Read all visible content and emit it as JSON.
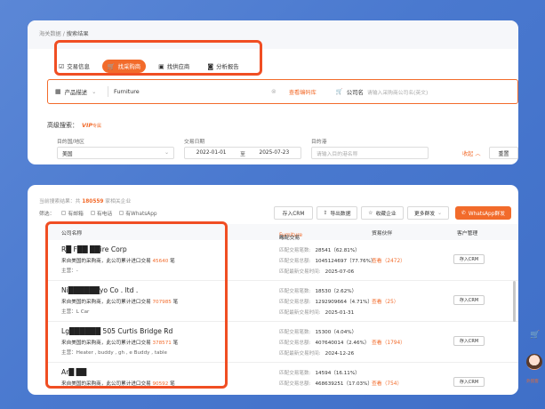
{
  "colors": {
    "accent": "#f26b2b",
    "highlight_box": "#f04e23",
    "background": "#4a79cf"
  },
  "breadcrumb": {
    "parent": "海关数据",
    "separator": " / ",
    "current": "搜索结果"
  },
  "mode_tabs": [
    {
      "label": "交易信息",
      "icon": "document-icon",
      "active": false
    },
    {
      "label": "找采购商",
      "icon": "cart-icon",
      "active": true
    },
    {
      "label": "找供应商",
      "icon": "supplier-icon",
      "active": false
    },
    {
      "label": "分析报告",
      "icon": "report-icon",
      "active": false
    }
  ],
  "search": {
    "type_label": "产品描述",
    "value": "Furniture",
    "code_link": "查看编码库",
    "company_label": "公司名",
    "company_placeholder": "请输入采购商公司名(英文)"
  },
  "advanced": {
    "title": "高级搜索：",
    "vip": "VIP",
    "vip_sub": "专属",
    "destination": {
      "label": "目的国/地区",
      "value": "美国"
    },
    "date": {
      "label": "交易日期",
      "from": "2022-01-01",
      "to_label": "至",
      "to": "2025-07-23"
    },
    "port": {
      "label": "目的港",
      "placeholder": "请输入目的港名称"
    },
    "collapse": "收起",
    "reset": "重置"
  },
  "results": {
    "count_prefix": "当前搜索结果：共",
    "count": "180559",
    "count_suffix": "家相关企业",
    "filter_label": "筛选：",
    "filters": [
      "有邮箱",
      "有电话",
      "有WhatsApp"
    ],
    "actions": {
      "crm": "存入CRM",
      "export": "导出数据",
      "favorite": "收藏企业",
      "more": "更多群发",
      "whatsapp": "WhatsApp群发"
    },
    "headers": {
      "company": "公司名称",
      "match_prefix": "与",
      "match_keyword": "Furniture",
      "match_suffix": "匹配交易",
      "partner": "贸易伙伴",
      "crm": "客户管理"
    },
    "labels": {
      "count": "匹配交易笔数:",
      "amount": "匹配交易总额:",
      "latest": "匹配最新交易时间:",
      "main": "主营："
    },
    "rows": [
      {
        "name": "R█ F██ ██ire Corp",
        "desc_prefix": "来自美国的采购商，此公司累计进口交易",
        "desc_count": "45640",
        "desc_suffix": "笔",
        "main": "-",
        "count": "28541（62.81%）",
        "amount": "1045124697（77.76%）",
        "latest": "2025-07-06",
        "partner": "查看（2472）",
        "crm": "存入CRM"
      },
      {
        "name": "Ni██████yo Co . ltd .",
        "desc_prefix": "来自美国的采购商，此公司累计进口交易",
        "desc_count": "707985",
        "desc_suffix": "笔",
        "main": "L Car",
        "count": "18530（2.62%）",
        "amount": "1292909664（4.71%）",
        "latest": "2025-01-31",
        "partner": "查看（25）",
        "crm": "存入CRM"
      },
      {
        "name": "Lg██████ 505 Curtis Bridge Rd",
        "desc_prefix": "来自美国的采购商，此公司累计进口交易",
        "desc_count": "378571",
        "desc_suffix": "笔",
        "main": "Heater , buddy , gh , e Buddy , table",
        "count": "15300（4.04%）",
        "amount": "407640014（2.46%）",
        "latest": "2024-12-26",
        "partner": "查看（1794）",
        "crm": "存入CRM"
      },
      {
        "name": "Ar█ ██",
        "desc_prefix": "来自美国的采购商，此公司累计进口交易",
        "desc_count": "90592",
        "desc_suffix": "笔",
        "main": "",
        "count": "14594（16.11%）",
        "amount": "468639251（17.03%）",
        "latest": "",
        "partner": "查看（754）",
        "crm": "存入CRM"
      }
    ]
  },
  "floating": {
    "cart_icon": "cart-icon",
    "cs_label": "外贸客"
  }
}
